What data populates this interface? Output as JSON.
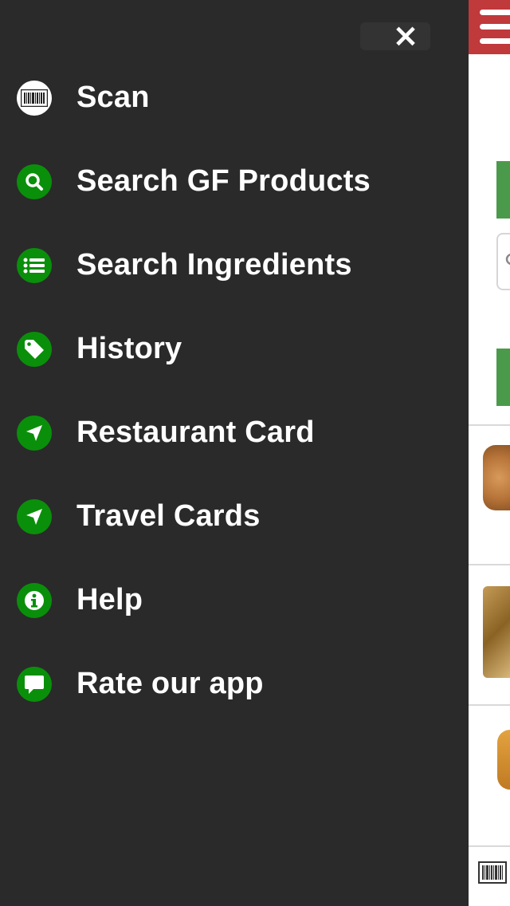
{
  "menu": {
    "close_icon": "×",
    "items": [
      {
        "label": "Scan",
        "icon": "barcode-icon"
      },
      {
        "label": "Search GF Products",
        "icon": "search-icon"
      },
      {
        "label": "Search Ingredients",
        "icon": "list-icon"
      },
      {
        "label": "History",
        "icon": "tag-icon"
      },
      {
        "label": "Restaurant Card",
        "icon": "location-arrow-icon"
      },
      {
        "label": "Travel Cards",
        "icon": "location-arrow-icon"
      },
      {
        "label": "Help",
        "icon": "info-icon"
      },
      {
        "label": "Rate our app",
        "icon": "chat-bubble-icon"
      }
    ]
  },
  "colors": {
    "drawer_bg": "#2a2a2a",
    "icon_green": "#0a8f0a",
    "header_red": "#c0393b",
    "accent_green": "#4b9a4b"
  }
}
